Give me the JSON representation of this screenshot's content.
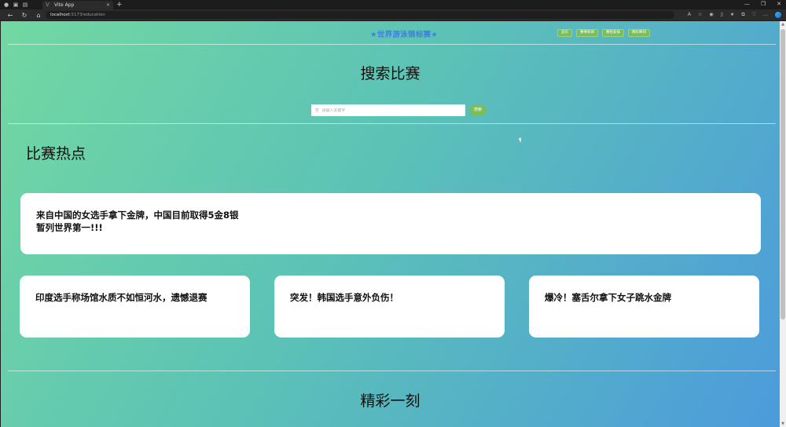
{
  "browser": {
    "tab_title": "Vite App",
    "url_host": "localhost",
    "url_path": ":5173/education",
    "new_tab": "+",
    "window_controls": [
      "—",
      "❐",
      "✕"
    ]
  },
  "site": {
    "title": "★世界游泳锦标赛★",
    "nav": [
      "首页",
      "赛事新闻",
      "赛程安排",
      "精彩瞬间"
    ]
  },
  "search": {
    "heading": "搜索比赛",
    "placeholder": "请输入关键字",
    "value": "",
    "button_label": "搜索"
  },
  "hot": {
    "heading": "比赛热点",
    "featured": {
      "line1": "来自中国的女选手拿下金牌，中国目前取得5金8银",
      "line2": "暂列世界第一!!!"
    },
    "items": [
      "印度选手称场馆水质不如恒河水，遗憾退赛",
      "突发！韩国选手意外负伤！",
      "爆冷！塞舌尔拿下女子跳水金牌"
    ]
  },
  "moments": {
    "heading": "精彩一刻"
  },
  "colors": {
    "accent_green": "#7bbd5a",
    "title_blue": "#3f7fe0"
  }
}
